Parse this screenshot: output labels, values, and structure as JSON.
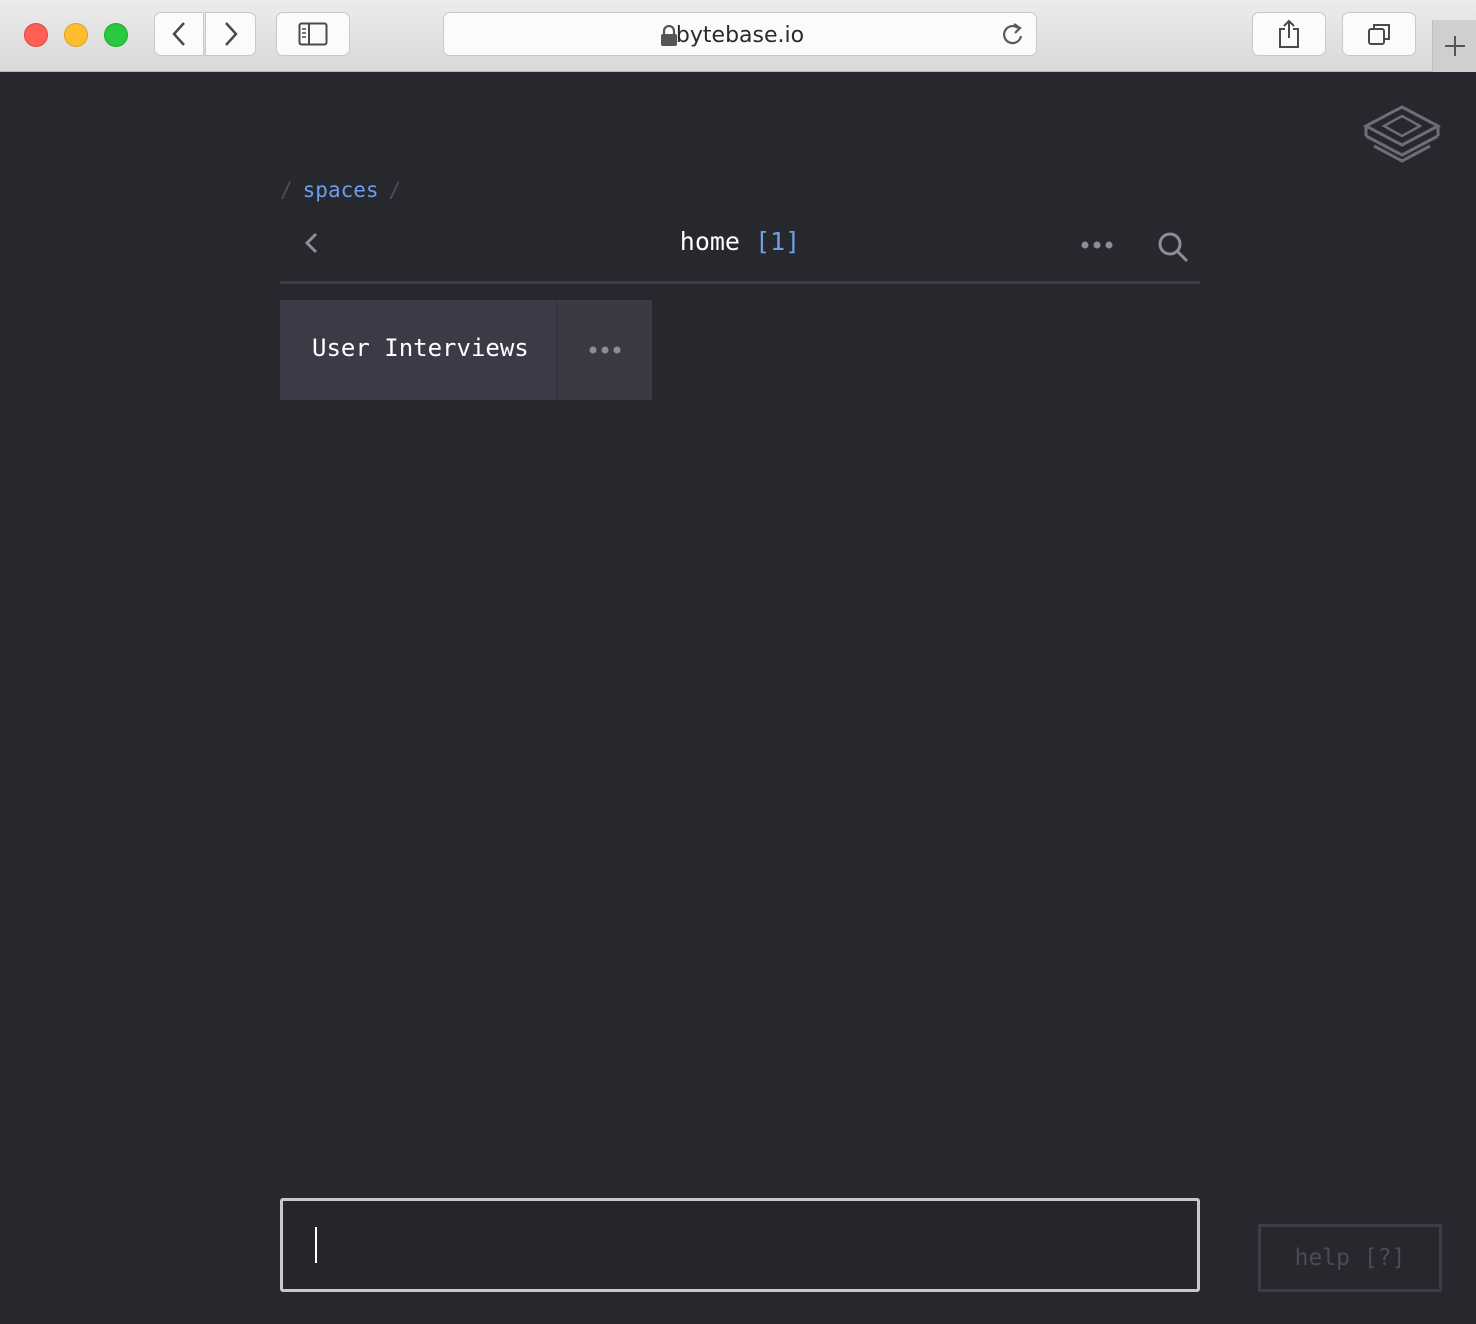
{
  "browser": {
    "url": "bytebase.io"
  },
  "breadcrumb": {
    "separator": "/",
    "items": [
      "spaces"
    ]
  },
  "header": {
    "title": "home",
    "count": "[1]"
  },
  "items": [
    {
      "label": "User Interviews"
    }
  ],
  "command_input": {
    "value": "",
    "placeholder": ""
  },
  "help": {
    "label": "help [?]"
  },
  "colors": {
    "background": "#27272e",
    "accent": "#6e9ee8",
    "card": "#3a3b46"
  }
}
